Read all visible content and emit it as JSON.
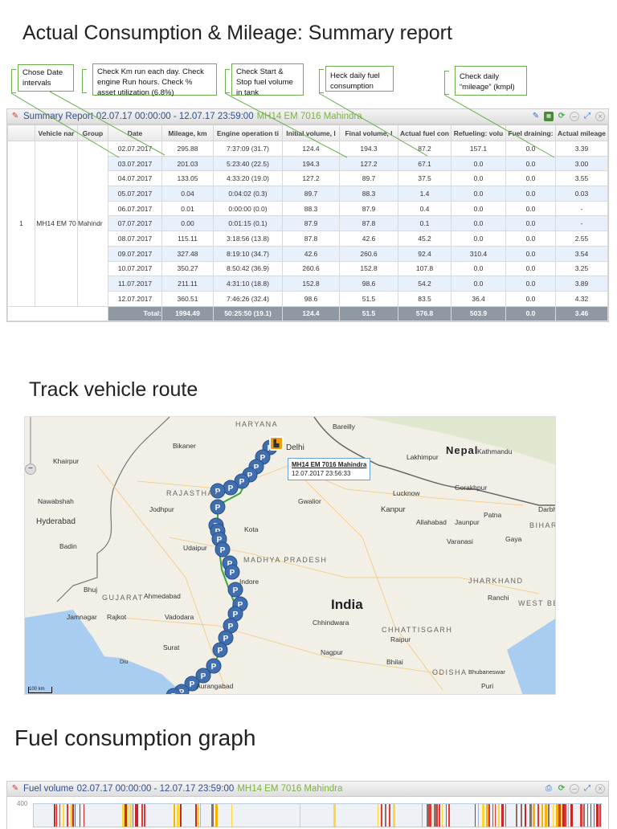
{
  "titles": {
    "summary": "Actual Consumption & Mileage: Summary report",
    "route": "Track vehicle route",
    "fuel": "Fuel consumption graph"
  },
  "callouts": [
    "Chose Date intervals",
    "Check Km run each day. Check engine Run hours. Check % asset utilization (6.8%)",
    "Check Start & Stop fuel volume in tank",
    "Heck daily fuel consumption",
    "Check daily “mileage” (kmpl)"
  ],
  "summary": {
    "title": "Summary Report",
    "range": "02.07.17 00:00:00 - 12.07.17 23:59:00",
    "vehicle": "MH14 EM 7016 Mahindra",
    "columns": [
      "",
      "Vehicle nar",
      "Group",
      "Date",
      "Mileage, km",
      "Engine operation ti",
      "Initial volume, l",
      "Final volume, l",
      "Actual fuel con",
      "Refueling: volu",
      "Fuel draining:",
      "Actual mileage"
    ],
    "row_num": "1",
    "vehicle_cell": "MH14 EM 70",
    "group_cell": "Mahindr",
    "rows": [
      [
        "02.07.2017",
        "295.88",
        "7:37:09 (31.7)",
        "124.4",
        "194.3",
        "87.2",
        "157.1",
        "0.0",
        "3.39"
      ],
      [
        "03.07.2017",
        "201.03",
        "5:23:40 (22.5)",
        "194.3",
        "127.2",
        "67.1",
        "0.0",
        "0.0",
        "3.00"
      ],
      [
        "04.07.2017",
        "133.05",
        "4:33:20 (19.0)",
        "127.2",
        "89.7",
        "37.5",
        "0.0",
        "0.0",
        "3.55"
      ],
      [
        "05.07.2017",
        "0.04",
        "0:04:02 (0.3)",
        "89.7",
        "88.3",
        "1.4",
        "0.0",
        "0.0",
        "0.03"
      ],
      [
        "06.07.2017",
        "0.01",
        "0:00:00 (0.0)",
        "88.3",
        "87.9",
        "0.4",
        "0.0",
        "0.0",
        "-"
      ],
      [
        "07.07.2017",
        "0.00",
        "0:01:15 (0.1)",
        "87.9",
        "87.8",
        "0.1",
        "0.0",
        "0.0",
        "-"
      ],
      [
        "08.07.2017",
        "115.11",
        "3:18:56 (13.8)",
        "87.8",
        "42.6",
        "45.2",
        "0.0",
        "0.0",
        "2.55"
      ],
      [
        "09.07.2017",
        "327.48",
        "8:19:10 (34.7)",
        "42.6",
        "260.6",
        "92.4",
        "310.4",
        "0.0",
        "3.54"
      ],
      [
        "10.07.2017",
        "350.27",
        "8:50:42 (36.9)",
        "260.6",
        "152.8",
        "107.8",
        "0.0",
        "0.0",
        "3.25"
      ],
      [
        "11.07.2017",
        "211.11",
        "4:31:10 (18.8)",
        "152.8",
        "98.6",
        "54.2",
        "0.0",
        "0.0",
        "3.89"
      ],
      [
        "12.07.2017",
        "360.51",
        "7:46:26 (32.4)",
        "98.6",
        "51.5",
        "83.5",
        "36.4",
        "0.0",
        "4.32"
      ]
    ],
    "total": [
      "Total:",
      "1994.49",
      "50:25:50 (19.1)",
      "124.4",
      "51.5",
      "576.8",
      "503.9",
      "0.0",
      "3.46"
    ]
  },
  "map": {
    "tooltip_vehicle": "MH14 EM 7016 Mahindra",
    "tooltip_time": "12.07.2017 23:56:33",
    "scale": "100 km",
    "labels": [
      "HARYANA",
      "Delhi",
      "Bareilly",
      "Bikaner",
      "Khairpur",
      "Nawabshah",
      "Hyderabad",
      "Badin",
      "RAJASTHAN",
      "Jodhpur",
      "Udaipur",
      "Kota",
      "Gwalior",
      "Lucknow",
      "Lakhimpur",
      "Kanpur",
      "Allahabad",
      "Jaunpur",
      "Varanasi",
      "Gorakhpur",
      "Nepal",
      "Kathmandu",
      "Patna",
      "Darbhanga",
      "BIHAR",
      "Gaya",
      "Bhuj",
      "GUJARAT",
      "Ahmedabad",
      "Jamnagar",
      "Rajkot",
      "Vadodara",
      "Surat",
      "Diu",
      "MADHYA PRADESH",
      "India",
      "Chhindwara",
      "Nagpur",
      "CHHATTISGARH",
      "Raipur",
      "Bhilai",
      "JHARKHAND",
      "Ranchi",
      "WEST BE",
      "ODISHA",
      "Bhubaneswar",
      "Puri",
      "Aurangabad",
      "Indore"
    ]
  },
  "fuel": {
    "title": "Fuel volume",
    "range": "02.07.17 00:00:00 - 12.07.17 23:59:00",
    "vehicle": "MH14 EM 7016 Mahindra",
    "y_top": "400"
  }
}
